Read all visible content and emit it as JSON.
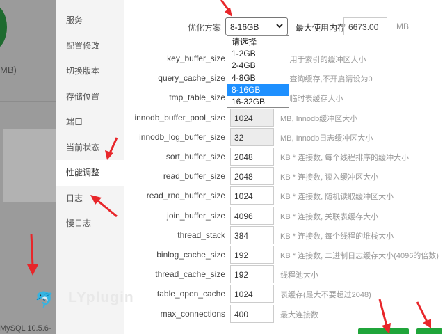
{
  "background": {
    "mb_text": "MB)",
    "mysql_version": "MySQL 10.5.6-",
    "dolphin_glyph": "🐬"
  },
  "sidebar": {
    "items": [
      {
        "label": "服务",
        "active": false
      },
      {
        "label": "配置修改",
        "active": false
      },
      {
        "label": "切换版本",
        "active": false
      },
      {
        "label": "存储位置",
        "active": false
      },
      {
        "label": "端口",
        "active": false
      },
      {
        "label": "当前状态",
        "active": false
      },
      {
        "label": "性能调整",
        "active": true
      },
      {
        "label": "日志",
        "active": false
      },
      {
        "label": "慢日志",
        "active": false
      }
    ],
    "watermark": "LYplugin"
  },
  "optimize": {
    "label": "优化方案",
    "selected": "8-16GB",
    "options": [
      "请选择",
      "1-2GB",
      "2-4GB",
      "4-8GB",
      "8-16GB",
      "16-32GB"
    ]
  },
  "max_memory": {
    "label": "最大使用内存",
    "value": "6673.00",
    "unit": "MB"
  },
  "params": [
    {
      "name": "key_buffer_size",
      "value": "",
      "desc": "B, 用于索引的缓冲区大小"
    },
    {
      "name": "query_cache_size",
      "value": "",
      "desc": "B, 查询缓存,不开启请设为0"
    },
    {
      "name": "tmp_table_size",
      "value": "",
      "desc": "B, 临时表缓存大小"
    },
    {
      "name": "innodb_buffer_pool_size",
      "value": "1024",
      "desc": "MB, Innodb缓冲区大小"
    },
    {
      "name": "innodb_log_buffer_size",
      "value": "32",
      "desc": "MB, Innodb日志缓冲区大小"
    },
    {
      "name": "sort_buffer_size",
      "value": "2048",
      "desc": "KB * 连接数, 每个线程排序的缓冲大小"
    },
    {
      "name": "read_buffer_size",
      "value": "2048",
      "desc": "KB * 连接数, 读入缓冲区大小"
    },
    {
      "name": "read_rnd_buffer_size",
      "value": "1024",
      "desc": "KB * 连接数, 随机读取缓冲区大小"
    },
    {
      "name": "join_buffer_size",
      "value": "4096",
      "desc": "KB * 连接数, 关联表缓存大小"
    },
    {
      "name": "thread_stack",
      "value": "384",
      "desc": "KB * 连接数, 每个线程的堆栈大小"
    },
    {
      "name": "binlog_cache_size",
      "value": "192",
      "desc": "KB * 连接数, 二进制日志缓存大小(4096的倍数)"
    },
    {
      "name": "thread_cache_size",
      "value": "192",
      "desc": "线程池大小"
    },
    {
      "name": "table_open_cache",
      "value": "1024",
      "desc": "表缓存(最大不要超过2048)"
    },
    {
      "name": "max_connections",
      "value": "400",
      "desc": "最大连接数"
    }
  ],
  "colors": {
    "arrow": "#e8262a",
    "button_green": "#20a53a",
    "dropdown_selected": "#1e90ff"
  },
  "icons": {
    "select_chevron": "chevron-down-icon",
    "annotation": "red-arrow-icon"
  }
}
